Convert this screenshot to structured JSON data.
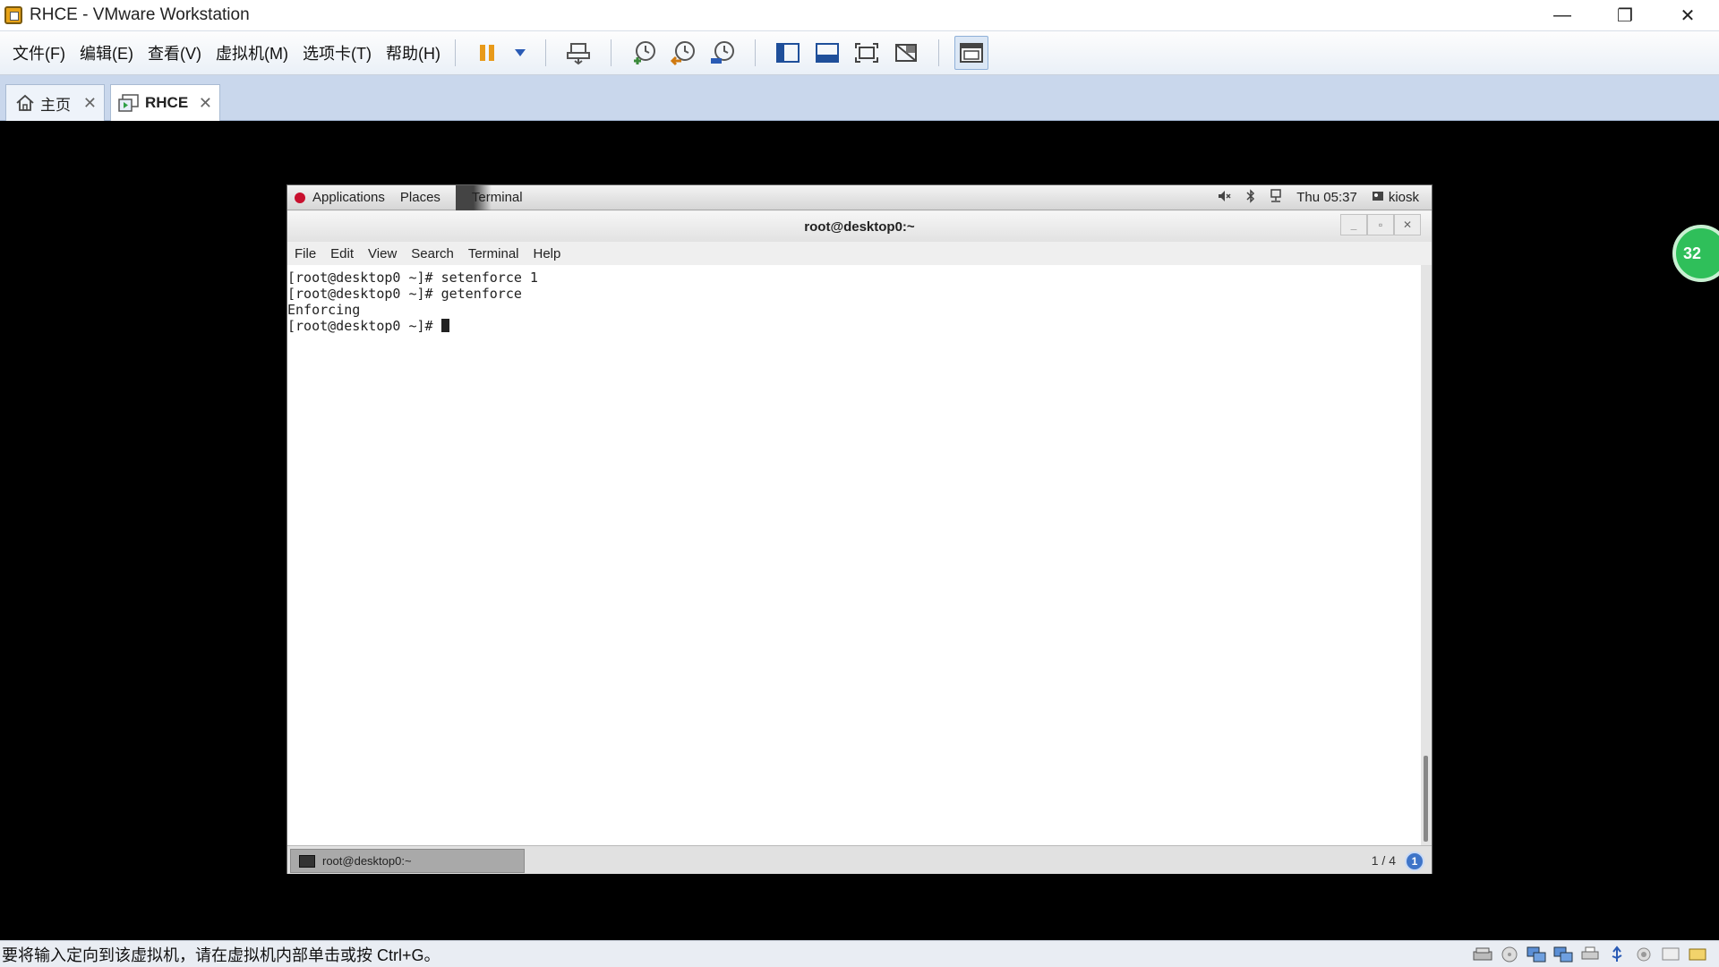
{
  "window": {
    "title": "RHCE - VMware Workstation",
    "minimize": "—",
    "restore": "❐",
    "close": "✕"
  },
  "menu": {
    "items": [
      "文件(F)",
      "编辑(E)",
      "查看(V)",
      "虚拟机(M)",
      "选项卡(T)",
      "帮助(H)"
    ]
  },
  "toolbar": {
    "icons": [
      "pause-icon",
      "dropdown-arrow-icon",
      "send-ctrl-alt-del-icon",
      "snapshot-take-icon",
      "snapshot-revert-icon",
      "snapshot-manager-icon",
      "library-view-icon",
      "thumbnail-bar-icon",
      "fullscreen-icon",
      "unity-icon",
      "console-view-icon"
    ]
  },
  "tabs": [
    {
      "label": "主页",
      "icon": "home-icon",
      "close": "✕"
    },
    {
      "label": "RHCE",
      "icon": "vm-icon",
      "close": "✕"
    }
  ],
  "badge": {
    "text": "32"
  },
  "guest": {
    "topbar": {
      "applications": "Applications",
      "places": "Places",
      "terminal": "Terminal",
      "clock": "Thu 05:37",
      "user": "kiosk"
    },
    "terminal_window": {
      "title": "root@desktop0:~",
      "menu": [
        "File",
        "Edit",
        "View",
        "Search",
        "Terminal",
        "Help"
      ],
      "lines": [
        "[root@desktop0 ~]# setenforce 1",
        "[root@desktop0 ~]# getenforce",
        "Enforcing",
        "[root@desktop0 ~]# "
      ]
    },
    "bottombar": {
      "task_label": "root@desktop0:~",
      "pager": "1 / 4",
      "info": "1"
    }
  },
  "statusbar": {
    "text": "要将输入定向到该虚拟机，请在虚拟机内部单击或按 Ctrl+G。",
    "icons": [
      "hard-disk-icon",
      "cd-dvd-icon",
      "network-icon",
      "network-2-icon",
      "printer-icon",
      "usb-icon",
      "sound-icon",
      "display-icon",
      "message-icon"
    ]
  }
}
